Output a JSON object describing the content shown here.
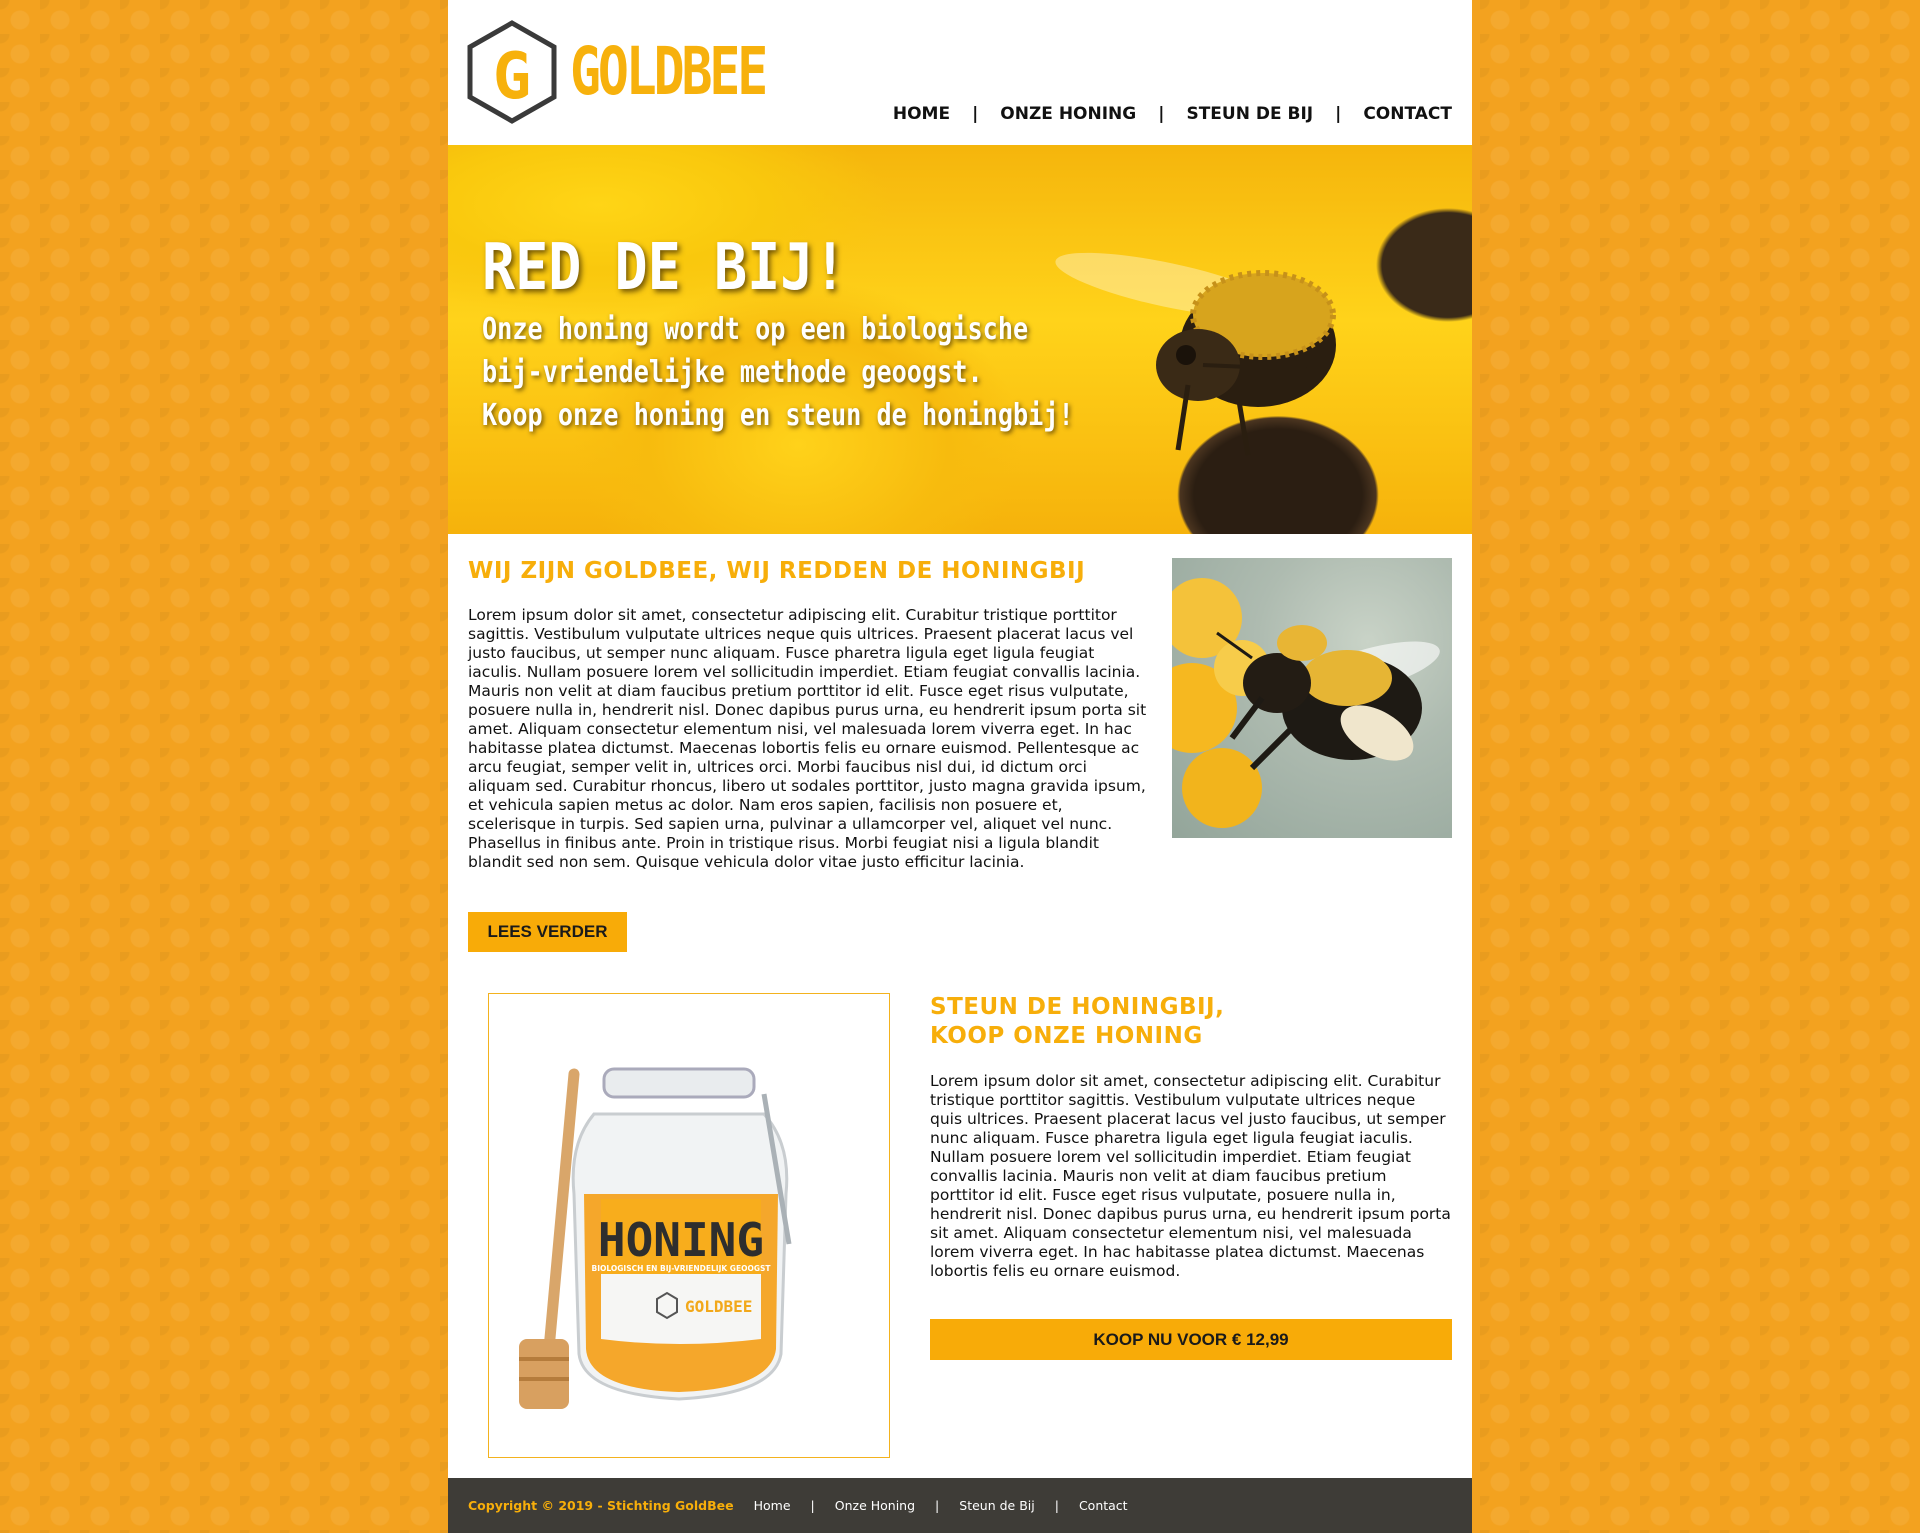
{
  "brand": {
    "logo_letter": "G",
    "name": "GOLDBEE",
    "accent_color": "#f7ae0a",
    "icon": "hexagon-logo-icon"
  },
  "nav": {
    "items": [
      {
        "label": "HOME"
      },
      {
        "label": "ONZE HONING"
      },
      {
        "label": "STEUN DE BIJ"
      },
      {
        "label": "CONTACT"
      }
    ],
    "separator": "|"
  },
  "hero": {
    "title": "RED DE BIJ!",
    "lines": [
      "Onze honing wordt op een biologische",
      "bij-vriendelijke methode geoogst.",
      "Koop onze honing en steun de honingbij!"
    ]
  },
  "about": {
    "title": "WIJ ZIJN GOLDBEE, WIJ REDDEN DE HONINGBIJ",
    "text": "Lorem ipsum dolor sit amet, consectetur adipiscing elit. Curabitur tristique porttitor sagittis. Vestibulum vulputate ultrices neque quis ultrices. Praesent placerat lacus vel justo faucibus, ut semper nunc aliquam. Fusce pharetra ligula eget ligula feugiat iaculis. Nullam posuere lorem vel sollicitudin imperdiet. Etiam feugiat convallis lacinia. Mauris non velit at diam faucibus pretium porttitor id elit. Fusce eget risus vulputate, posuere nulla in, hendrerit nisl. Donec dapibus purus urna, eu hendrerit ipsum porta sit amet. Aliquam consectetur elementum nisi, vel malesuada lorem viverra eget. In hac habitasse platea dictumst. Maecenas lobortis felis eu ornare euismod. Pellentesque ac arcu feugiat, semper velit in, ultrices orci. Morbi faucibus nisl dui, id dictum orci aliquam sed. Curabitur rhoncus, libero ut sodales porttitor, justo magna gravida ipsum, et vehicula sapien metus ac dolor. Nam eros sapien, facilisis non posuere et, scelerisque in turpis. Sed sapien urna, pulvinar a ullamcorper vel, aliquet vel nunc. Phasellus in finibus ante. Proin in tristique risus. Morbi feugiat nisi a ligula blandit blandit sed non sem. Quisque vehicula dolor vitae justo efficitur lacinia.",
    "button": "LEES VERDER"
  },
  "product": {
    "title_line1": "STEUN DE HONINGBIJ,",
    "title_line2": "KOOP ONZE HONING",
    "text": "Lorem ipsum dolor sit amet, consectetur adipiscing elit. Curabitur tristique porttitor sagittis. Vestibulum vulputate ultrices neque quis ultrices. Praesent placerat lacus vel justo faucibus, ut semper nunc aliquam. Fusce pharetra ligula eget ligula feugiat iaculis. Nullam posuere lorem vel sollicitudin imperdiet. Etiam feugiat convallis lacinia. Mauris non velit at diam faucibus pretium porttitor id elit. Fusce eget risus vulputate, posuere nulla in, hendrerit nisl. Donec dapibus purus urna, eu hendrerit ipsum porta sit amet. Aliquam consectetur elementum nisi, vel malesuada lorem viverra eget. In hac habitasse platea dictumst. Maecenas lobortis felis eu ornare euismod.",
    "button": "KOOP NU VOOR € 12,99",
    "jar_label": {
      "title": "HONING",
      "subtitle": "BIOLOGISCH EN BIJ-VRIENDELIJK GEOOGST",
      "brand": "GOLDBEE"
    }
  },
  "footer": {
    "copyright": "Copyright © 2019 - Stichting GoldBee",
    "links": [
      {
        "label": "Home"
      },
      {
        "label": "Onze Honing"
      },
      {
        "label": "Steun de Bij"
      },
      {
        "label": "Contact"
      }
    ],
    "separator": "|"
  }
}
